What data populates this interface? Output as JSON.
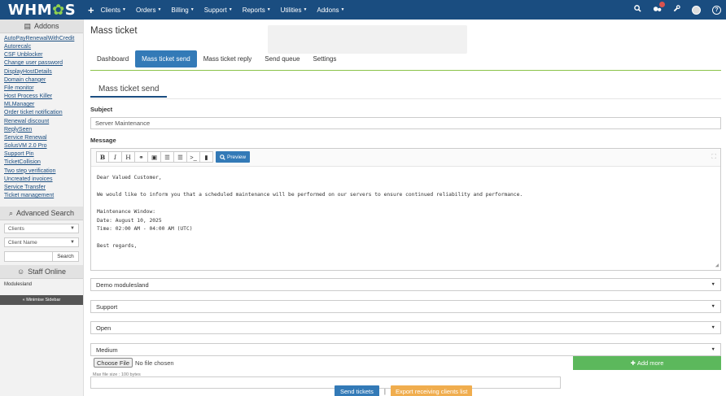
{
  "topbar": {
    "logo": "WHMCS",
    "logo_gear": "✿",
    "nav": [
      "Clients",
      "Orders",
      "Billing",
      "Support",
      "Reports",
      "Utilities",
      "Addons"
    ]
  },
  "sidebar": {
    "addons_title": "Addons",
    "addons": [
      "AutoPayRenewalWithCredit",
      "Autorecalc",
      "CSF Unblocker",
      "Change user password",
      "DisplayHostDetails",
      "Domain changer",
      "File monitor",
      "Host Process Killer",
      "MLManager",
      "Order ticket notification",
      "Renewal discount",
      "ReplySeen",
      "Service Renewal",
      "SolusVM 2.0 Pro",
      "Support Pin",
      "TicketCollision",
      "Two step verification",
      "Uncreated invoices",
      "Service Transfer",
      "Ticket management"
    ],
    "advanced_search_title": "Advanced Search",
    "search_type": "Clients",
    "search_field": "Client Name",
    "search_button": "Search",
    "staff_title": "Staff Online",
    "staff": [
      "Modulesland"
    ],
    "minimise": "« Minimise Sidebar"
  },
  "main": {
    "title": "Mass ticket",
    "tabs": [
      "Dashboard",
      "Mass ticket send",
      "Mass ticket reply",
      "Send queue",
      "Settings"
    ],
    "active_tab": "Mass ticket send",
    "section_title": "Mass ticket send",
    "subject_label": "Subject",
    "subject_value": "Server Maintenance",
    "message_label": "Message",
    "preview_label": "Preview",
    "message_lines": [
      "Dear Valued Customer,",
      "",
      "We would like to inform you that a scheduled maintenance will be performed on our servers to ensure continued reliability and performance.",
      "",
      "Maintenance Window:",
      "Date: August 10, 2025",
      "Time: 02:00 AM - 04:00 AM (UTC)",
      "",
      "Best regards,"
    ],
    "dropdowns": {
      "department": "Demo modulesland",
      "type": "Support",
      "status": "Open",
      "priority": "Medium"
    },
    "choose_file": "Choose File",
    "no_file": "No file chosen",
    "add_more": "Add more",
    "max_size": "Max file size : 100 bytes",
    "send_button": "Send tickets",
    "separator": "|",
    "export_button": "Export receiving clients list"
  },
  "colors": {
    "topbar": "#1a4d80",
    "primary": "#337ab7",
    "success": "#5cb85c",
    "warning": "#f0ad4e",
    "tab_underline": "#8bc34a"
  }
}
